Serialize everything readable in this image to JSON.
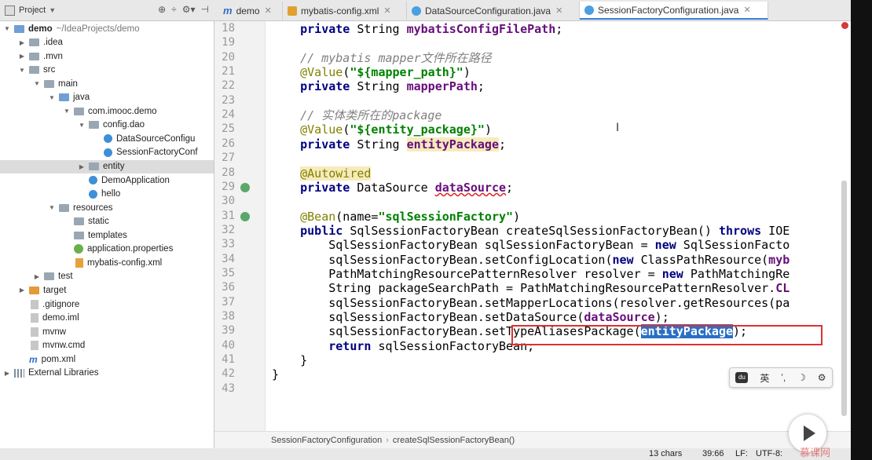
{
  "project_panel": {
    "title": "Project",
    "tools": [
      "⊕",
      "÷",
      "⚙▾",
      "⊣"
    ]
  },
  "tabs": [
    {
      "label": "demo",
      "icon": "m"
    },
    {
      "label": "mybatis-config.xml",
      "icon": "x"
    },
    {
      "label": "DataSourceConfiguration.java",
      "icon": "c"
    },
    {
      "label": "SessionFactoryConfiguration.java",
      "icon": "c"
    }
  ],
  "tree": [
    {
      "label": "demo",
      "extra": "~/IdeaProjects/demo",
      "depth": 0,
      "arrow": "▼",
      "icon": "fold-blue",
      "bold": true
    },
    {
      "label": ".idea",
      "depth": 1,
      "arrow": "▶",
      "icon": "fold"
    },
    {
      "label": ".mvn",
      "depth": 1,
      "arrow": "▶",
      "icon": "fold"
    },
    {
      "label": "src",
      "depth": 1,
      "arrow": "▼",
      "icon": "fold"
    },
    {
      "label": "main",
      "depth": 2,
      "arrow": "▼",
      "icon": "fold"
    },
    {
      "label": "java",
      "depth": 3,
      "arrow": "▼",
      "icon": "fold-blue"
    },
    {
      "label": "com.imooc.demo",
      "depth": 4,
      "arrow": "▼",
      "icon": "fold"
    },
    {
      "label": "config.dao",
      "depth": 5,
      "arrow": "▼",
      "icon": "fold"
    },
    {
      "label": "DataSourceConfigu",
      "depth": 6,
      "arrow": "",
      "icon": "cls"
    },
    {
      "label": "SessionFactoryConf",
      "depth": 6,
      "arrow": "",
      "icon": "cls"
    },
    {
      "label": "entity",
      "depth": 5,
      "arrow": "▶",
      "icon": "fold",
      "selected": true
    },
    {
      "label": "DemoApplication",
      "depth": 5,
      "arrow": "",
      "icon": "cls"
    },
    {
      "label": "hello",
      "depth": 5,
      "arrow": "",
      "icon": "cls"
    },
    {
      "label": "resources",
      "depth": 3,
      "arrow": "▼",
      "icon": "fold"
    },
    {
      "label": "static",
      "depth": 4,
      "arrow": "",
      "icon": "fold"
    },
    {
      "label": "templates",
      "depth": 4,
      "arrow": "",
      "icon": "fold"
    },
    {
      "label": "application.properties",
      "depth": 4,
      "arrow": "",
      "icon": "leaf"
    },
    {
      "label": "mybatis-config.xml",
      "depth": 4,
      "arrow": "",
      "icon": "xml"
    },
    {
      "label": "test",
      "depth": 2,
      "arrow": "▶",
      "icon": "fold"
    },
    {
      "label": "target",
      "depth": 1,
      "arrow": "▶",
      "icon": "fold-or"
    },
    {
      "label": ".gitignore",
      "depth": 1,
      "arrow": "",
      "icon": "file"
    },
    {
      "label": "demo.iml",
      "depth": 1,
      "arrow": "",
      "icon": "file"
    },
    {
      "label": "mvnw",
      "depth": 1,
      "arrow": "",
      "icon": "file"
    },
    {
      "label": "mvnw.cmd",
      "depth": 1,
      "arrow": "",
      "icon": "file"
    },
    {
      "label": "pom.xml",
      "depth": 1,
      "arrow": "",
      "icon": "m"
    },
    {
      "label": "External Libraries",
      "depth": 0,
      "arrow": "▶",
      "icon": "lib"
    }
  ],
  "editor": {
    "lines": [
      {
        "n": "18",
        "t": [
          [
            "    ",
            ""
          ],
          [
            "private ",
            "kw"
          ],
          [
            "String ",
            ""
          ],
          [
            "mybatisConfigFilePath",
            "fld"
          ],
          [
            ";",
            ""
          ]
        ]
      },
      {
        "n": "19",
        "t": []
      },
      {
        "n": "20",
        "t": [
          [
            "    ",
            ""
          ],
          [
            "// mybatis mapper文件所在路径",
            "cmt"
          ]
        ]
      },
      {
        "n": "21",
        "t": [
          [
            "    ",
            ""
          ],
          [
            "@Value",
            "ann"
          ],
          [
            "(",
            ""
          ],
          [
            "\"${mapper_path}\"",
            "str"
          ],
          [
            ")",
            ""
          ]
        ]
      },
      {
        "n": "22",
        "t": [
          [
            "    ",
            ""
          ],
          [
            "private ",
            "kw"
          ],
          [
            "String ",
            ""
          ],
          [
            "mapperPath",
            "fld"
          ],
          [
            ";",
            ""
          ]
        ]
      },
      {
        "n": "23",
        "t": []
      },
      {
        "n": "24",
        "t": [
          [
            "    ",
            ""
          ],
          [
            "// 实体类所在的package",
            "cmt"
          ]
        ]
      },
      {
        "n": "25",
        "t": [
          [
            "    ",
            ""
          ],
          [
            "@Value",
            "ann"
          ],
          [
            "(",
            ""
          ],
          [
            "\"${entity_package}\"",
            "str"
          ],
          [
            ")",
            ""
          ]
        ]
      },
      {
        "n": "26",
        "t": [
          [
            "    ",
            ""
          ],
          [
            "private ",
            "kw"
          ],
          [
            "String ",
            ""
          ],
          [
            "entityPackage",
            "fld hl"
          ],
          [
            ";",
            ""
          ]
        ]
      },
      {
        "n": "27",
        "t": []
      },
      {
        "n": "28",
        "t": [
          [
            "    ",
            ""
          ],
          [
            "@Autowired",
            "ann hl"
          ]
        ]
      },
      {
        "n": "29",
        "t": [
          [
            "    ",
            ""
          ],
          [
            "private ",
            "kw"
          ],
          [
            "DataSource ",
            ""
          ],
          [
            "dataSource",
            "fld sq"
          ],
          [
            ";",
            ""
          ]
        ]
      },
      {
        "n": "30",
        "t": []
      },
      {
        "n": "31",
        "t": [
          [
            "    ",
            ""
          ],
          [
            "@Bean",
            "ann"
          ],
          [
            "(name=",
            ""
          ],
          [
            "\"sqlSessionFactory\"",
            "str"
          ],
          [
            ")",
            ""
          ]
        ]
      },
      {
        "n": "32",
        "t": [
          [
            "    ",
            ""
          ],
          [
            "public ",
            "kw"
          ],
          [
            "SqlSessionFactoryBean createSqlSessionFactoryBean() ",
            ""
          ],
          [
            "throws ",
            "kw"
          ],
          [
            "IOE",
            ""
          ]
        ]
      },
      {
        "n": "33",
        "t": [
          [
            "        SqlSessionFactoryBean sqlSessionFactoryBean = ",
            ""
          ],
          [
            "new ",
            "kw"
          ],
          [
            "SqlSessionFacto",
            ""
          ]
        ]
      },
      {
        "n": "34",
        "t": [
          [
            "        sqlSessionFactoryBean.setConfigLocation(",
            ""
          ],
          [
            "new ",
            "kw"
          ],
          [
            "ClassPathResource(",
            ""
          ],
          [
            "myb",
            "fld"
          ]
        ]
      },
      {
        "n": "35",
        "t": [
          [
            "        PathMatchingResourcePatternResolver resolver = ",
            ""
          ],
          [
            "new ",
            "kw"
          ],
          [
            "PathMatchingRe",
            ""
          ]
        ]
      },
      {
        "n": "36",
        "t": [
          [
            "        String packageSearchPath = PathMatchingResourcePatternResolver.",
            ""
          ],
          [
            "CL",
            "fld"
          ]
        ]
      },
      {
        "n": "37",
        "t": [
          [
            "        sqlSessionFactoryBean.setMapperLocations(resolver.getResources(pa",
            ""
          ]
        ]
      },
      {
        "n": "38",
        "t": [
          [
            "        sqlSessionFactoryBean.setDataSource(",
            ""
          ],
          [
            "dataSource",
            "fld"
          ],
          [
            ");",
            ""
          ]
        ]
      },
      {
        "n": "39",
        "t": [
          [
            "        sqlSessionFactoryBean.setTypeAliasesPackage(",
            ""
          ],
          [
            "entityPackage",
            "fld selw"
          ],
          [
            ");",
            ""
          ]
        ]
      },
      {
        "n": "40",
        "t": [
          [
            "        ",
            ""
          ],
          [
            "return ",
            "kw"
          ],
          [
            "sqlSessionFactoryBean;",
            ""
          ]
        ]
      },
      {
        "n": "41",
        "t": [
          [
            "    }",
            ""
          ]
        ]
      },
      {
        "n": "42",
        "t": [
          [
            "}",
            ""
          ]
        ]
      },
      {
        "n": "43",
        "t": []
      }
    ]
  },
  "breadcrumbs": [
    "SessionFactoryConfiguration",
    "createSqlSessionFactoryBean()"
  ],
  "status": {
    "chars": "13 chars",
    "pos": "39:66",
    "lf": "LF:",
    "enc": "UTF-8:"
  },
  "ime": {
    "lang": "英",
    "punct": "ʼ,",
    "moon": "☽",
    "gear": "⚙",
    "logo": "du"
  },
  "watermark": "慕课网"
}
